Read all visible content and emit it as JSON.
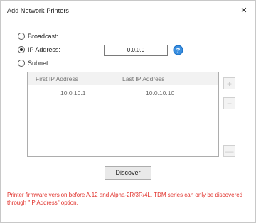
{
  "window": {
    "title": "Add Network Printers",
    "close_label": "✕"
  },
  "options": {
    "broadcast_label": "Broadcast:",
    "ip_address_label": "IP Address:",
    "subnet_label": "Subnet:",
    "selected": "ip_address"
  },
  "ip_input": {
    "value": "0.0.0.0"
  },
  "help_icon": "help-icon",
  "subnet_table": {
    "columns": [
      "First IP Address",
      "Last IP Address"
    ],
    "rows": [
      [
        "10.0.10.1",
        "10.0.10.10"
      ]
    ]
  },
  "side_buttons": {
    "add_label": "+",
    "remove_label": "−",
    "clear_label": "—"
  },
  "discover_label": "Discover",
  "note": "Printer firmware version before A.12 and Alpha-2R/3R/4L, TDM series can only be discovered through \"IP Address\" option.",
  "colors": {
    "note_text": "#e0302a",
    "help_icon_blue": "#1e73c8"
  }
}
